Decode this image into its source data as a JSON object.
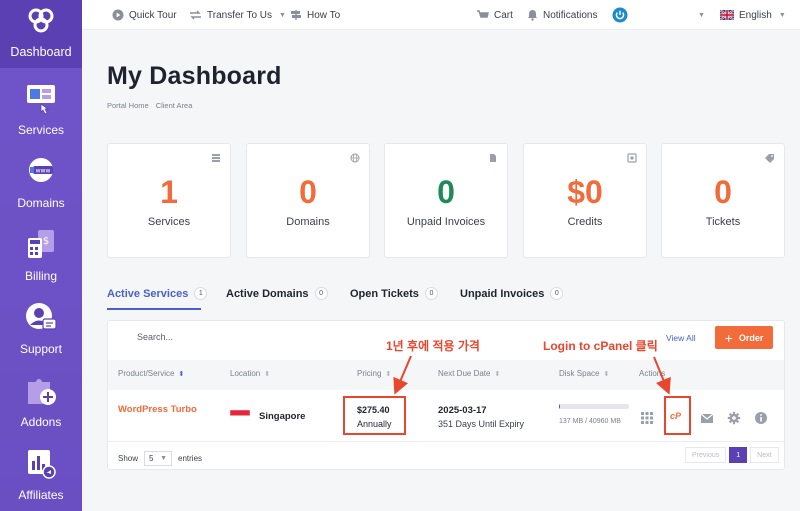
{
  "sidebar": {
    "logo_label": "Dashboard",
    "items": [
      {
        "label": "Services",
        "icon": "services-icon"
      },
      {
        "label": "Domains",
        "icon": "domains-icon"
      },
      {
        "label": "Billing",
        "icon": "billing-icon"
      },
      {
        "label": "Support",
        "icon": "support-icon"
      },
      {
        "label": "Addons",
        "icon": "addons-icon"
      },
      {
        "label": "Affiliates",
        "icon": "affiliates-icon"
      }
    ]
  },
  "topbar": {
    "quick_tour": "Quick Tour",
    "transfer": "Transfer To Us",
    "how_to": "How To",
    "cart": "Cart",
    "notifications": "Notifications",
    "language": "English"
  },
  "header": {
    "title": "My Dashboard",
    "breadcrumb": [
      "Portal Home",
      "Client Area"
    ]
  },
  "stats": [
    {
      "value": "1",
      "label": "Services",
      "color": "#f26b3a",
      "icon": "server-icon"
    },
    {
      "value": "0",
      "label": "Domains",
      "color": "#f26b3a",
      "icon": "globe-icon"
    },
    {
      "value": "0",
      "label": "Unpaid Invoices",
      "color": "#1e8a5a",
      "icon": "document-icon"
    },
    {
      "value": "$0",
      "label": "Credits",
      "color": "#f26b3a",
      "icon": "wallet-icon"
    },
    {
      "value": "0",
      "label": "Tickets",
      "color": "#f26b3a",
      "icon": "tag-icon"
    }
  ],
  "tabs": [
    {
      "label": "Active Services",
      "count": "1"
    },
    {
      "label": "Active Domains",
      "count": "0"
    },
    {
      "label": "Open Tickets",
      "count": "0"
    },
    {
      "label": "Unpaid Invoices",
      "count": "0"
    }
  ],
  "table": {
    "search_placeholder": "Search...",
    "view_all": "View All",
    "order": "Order",
    "columns": [
      "Product/Service",
      "Location",
      "Pricing",
      "Next Due Date",
      "Disk Space",
      "Actions"
    ],
    "row": {
      "product": "WordPress Turbo",
      "location": "Singapore",
      "price": "$275.40",
      "cycle": "Annually",
      "due_date": "2025-03-17",
      "due_sub": "351 Days Until Expiry",
      "disk": "137 MB / 40960 MB",
      "disk_fraction": 0.0033
    },
    "show_label": "Show",
    "show_value": "5",
    "entries_label": "entries",
    "pager": {
      "previous": "Previous",
      "page": "1",
      "next": "Next"
    }
  },
  "annotations": {
    "price_note": "1년 후에 적용 가격",
    "cpanel_note": "Login to cPanel 클릭"
  },
  "colors": {
    "accent": "#f26b3a",
    "primary": "#4a61c9",
    "sidebar": "#6a4fc3",
    "annotation": "#e8462d"
  }
}
